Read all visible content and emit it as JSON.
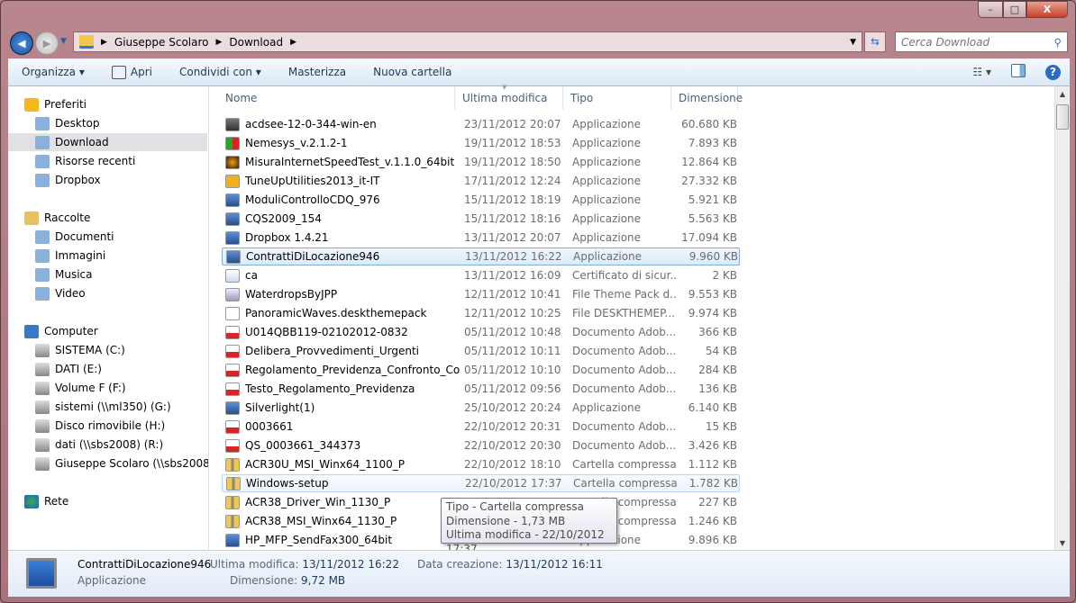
{
  "window": {
    "controls": {
      "minimize": "–",
      "maximize": "□",
      "close": "X"
    }
  },
  "address": {
    "crumbs": [
      "Giuseppe Scolaro",
      "Download"
    ],
    "search_placeholder": "Cerca Download"
  },
  "toolbar": {
    "organize": "Organizza ▾",
    "open": "Apri",
    "share": "Condividi con ▾",
    "burn": "Masterizza",
    "new_folder": "Nuova cartella"
  },
  "nav": {
    "favorites": {
      "label": "Preferiti",
      "items": [
        "Desktop",
        "Download",
        "Risorse recenti",
        "Dropbox"
      ],
      "selected": "Download"
    },
    "libraries": {
      "label": "Raccolte",
      "items": [
        "Documenti",
        "Immagini",
        "Musica",
        "Video"
      ]
    },
    "computer": {
      "label": "Computer",
      "items": [
        "SISTEMA (C:)",
        "DATI (E:)",
        "Volume F (F:)",
        "sistemi (\\\\ml350) (G:)",
        "Disco rimovibile (H:)",
        "dati (\\\\sbs2008) (R:)",
        "Giuseppe Scolaro (\\\\sbs2008\\users)"
      ]
    },
    "network": {
      "label": "Rete"
    }
  },
  "columns": [
    "Nome",
    "Ultima modifica",
    "Tipo",
    "Dimensione"
  ],
  "files": [
    {
      "name": "acdsee-12-0-344-win-en",
      "date": "23/11/2012 20:07",
      "type": "Applicazione",
      "size": "60.680 KB",
      "icon": "app"
    },
    {
      "name": "Nemesys_v.2.1.2-1",
      "date": "19/11/2012 18:53",
      "type": "Applicazione",
      "size": "7.893 KB",
      "icon": "app-red"
    },
    {
      "name": "MisuraInternetSpeedTest_v.1.1.0_64bit",
      "date": "19/11/2012 18:50",
      "type": "Applicazione",
      "size": "12.864 KB",
      "icon": "app-disc"
    },
    {
      "name": "TuneUpUtilities2013_it-IT",
      "date": "17/11/2012 12:24",
      "type": "Applicazione",
      "size": "27.332 KB",
      "icon": "app-yellow"
    },
    {
      "name": "ModuliControlloCDQ_976",
      "date": "15/11/2012 18:19",
      "type": "Applicazione",
      "size": "5.921 KB",
      "icon": "setup"
    },
    {
      "name": "CQS2009_154",
      "date": "15/11/2012 18:16",
      "type": "Applicazione",
      "size": "5.563 KB",
      "icon": "setup"
    },
    {
      "name": "Dropbox 1.4.21",
      "date": "13/11/2012 20:07",
      "type": "Applicazione",
      "size": "17.094 KB",
      "icon": "setup"
    },
    {
      "name": "ContrattiDiLocazione946",
      "date": "13/11/2012 16:22",
      "type": "Applicazione",
      "size": "9.960 KB",
      "icon": "setup"
    },
    {
      "name": "ca",
      "date": "13/11/2012 16:09",
      "type": "Certificato di sicur...",
      "size": "2 KB",
      "icon": "cert"
    },
    {
      "name": "WaterdropsByJPP",
      "date": "12/11/2012 10:41",
      "type": "File Theme Pack d...",
      "size": "9.553 KB",
      "icon": "theme"
    },
    {
      "name": "PanoramicWaves.deskthemepack",
      "date": "12/11/2012 10:25",
      "type": "File DESKTHEMEP...",
      "size": "9.974 KB",
      "icon": "doc"
    },
    {
      "name": "U014QBB119-02102012-0832",
      "date": "05/11/2012 10:48",
      "type": "Documento Adob...",
      "size": "366 KB",
      "icon": "pdf"
    },
    {
      "name": "Delibera_Provvedimenti_Urgenti",
      "date": "05/11/2012 10:11",
      "type": "Documento Adob...",
      "size": "54 KB",
      "icon": "pdf"
    },
    {
      "name": "Regolamento_Previdenza_Confronto_Co...",
      "date": "05/11/2012 10:10",
      "type": "Documento Adob...",
      "size": "284 KB",
      "icon": "pdf"
    },
    {
      "name": "Testo_Regolamento_Previdenza",
      "date": "05/11/2012 09:56",
      "type": "Documento Adob...",
      "size": "136 KB",
      "icon": "pdf"
    },
    {
      "name": "Silverlight(1)",
      "date": "25/10/2012 20:24",
      "type": "Applicazione",
      "size": "6.140 KB",
      "icon": "setup"
    },
    {
      "name": "0003661",
      "date": "22/10/2012 20:31",
      "type": "Documento Adob...",
      "size": "15 KB",
      "icon": "pdf"
    },
    {
      "name": "QS_0003661_344373",
      "date": "22/10/2012 20:30",
      "type": "Documento Adob...",
      "size": "3.426 KB",
      "icon": "pdf"
    },
    {
      "name": "ACR30U_MSI_Winx64_1100_P",
      "date": "22/10/2012 18:10",
      "type": "Cartella compressa",
      "size": "1.112 KB",
      "icon": "zip"
    },
    {
      "name": "Windows-setup",
      "date": "22/10/2012 17:37",
      "type": "Cartella compressa",
      "size": "1.782 KB",
      "icon": "zip"
    },
    {
      "name": "ACR38_Driver_Win_1130_P",
      "date": "",
      "type": "Cartella compressa",
      "size": "227 KB",
      "icon": "zip"
    },
    {
      "name": "ACR38_MSI_Winx64_1130_P",
      "date": "",
      "type": "Cartella compressa",
      "size": "1.246 KB",
      "icon": "zip"
    },
    {
      "name": "HP_MFP_SendFax300_64bit",
      "date": "",
      "type": "Applicazione",
      "size": "9.896 KB",
      "icon": "setup"
    }
  ],
  "selected_index": 7,
  "hover_index": 19,
  "tooltip": {
    "line1": "Tipo - Cartella compressa",
    "line2": "Dimensione - 1,73 MB",
    "line3": "Ultima modifica - 22/10/2012 17:37"
  },
  "details": {
    "name": "ContrattiDiLocazione946",
    "type": "Applicazione",
    "modified_label": "Ultima modifica:",
    "modified": "13/11/2012 16:22",
    "size_label": "Dimensione:",
    "size": "9,72 MB",
    "created_label": "Data creazione:",
    "created": "13/11/2012 16:11"
  }
}
